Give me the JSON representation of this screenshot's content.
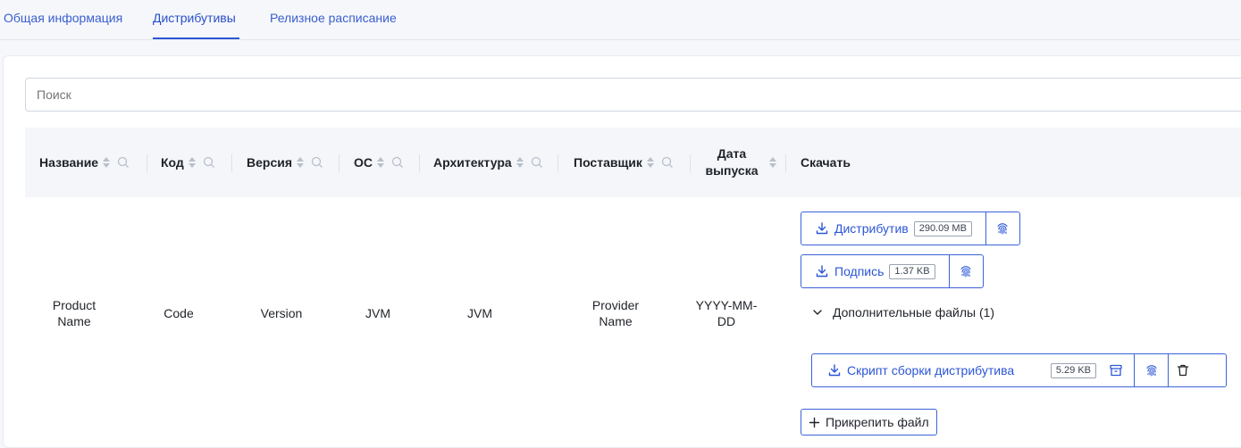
{
  "tabs": [
    {
      "label": "Общая информация"
    },
    {
      "label": "Дистрибутивы"
    },
    {
      "label": "Релизное расписание"
    }
  ],
  "search": {
    "placeholder": "Поиск"
  },
  "table": {
    "columns": [
      {
        "label": "Название"
      },
      {
        "label": "Код"
      },
      {
        "label": "Версия"
      },
      {
        "label": "ОС"
      },
      {
        "label": "Архитектура"
      },
      {
        "label": "Поставщик"
      },
      {
        "label": "Дата выпуска"
      },
      {
        "label": "Скачать"
      }
    ],
    "row": {
      "name_line1": "Product",
      "name_line2": "Name",
      "code": "Code",
      "version": "Version",
      "os": "JVM",
      "arch": "JVM",
      "provider_line1": "Provider",
      "provider_line2": "Name",
      "date_line1": "YYYY-MM-",
      "date_line2": "DD"
    }
  },
  "downloads": {
    "distributive": {
      "label": "Дистрибутив",
      "size": "290.09 MB"
    },
    "signature": {
      "label": "Подпись",
      "size": "1.37 KB"
    },
    "extra_files_label": "Дополнительные файлы (1)",
    "script": {
      "label": "Скрипт сборки дистрибутива",
      "size": "5.29 KB"
    },
    "attach_label": "Прикрепить файл"
  },
  "icons": {
    "download": "download-icon",
    "fingerprint": "fingerprint-icon",
    "archive": "archive-icon",
    "trash": "trash-icon",
    "chevron": "chevron-down-icon",
    "plus": "plus-icon",
    "search": "search-icon"
  },
  "colors": {
    "accent": "#2b56d6",
    "text": "#1f2329",
    "muted": "#8a94a3"
  }
}
